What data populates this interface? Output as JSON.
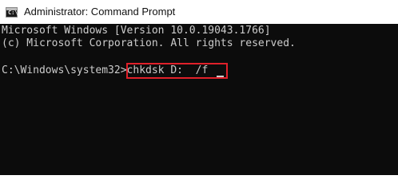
{
  "window": {
    "title": "Administrator: Command Prompt",
    "icon": "cmd-icon"
  },
  "console": {
    "line1": "Microsoft Windows [Version 10.0.19043.1766]",
    "line2": "(c) Microsoft Corporation. All rights reserved.",
    "prompt": "C:\\Windows\\system32>",
    "command": "chkdsk D:  /f",
    "highlight_color": "#e0202a",
    "background": "#0c0c0c",
    "text_color": "#cccccc"
  }
}
